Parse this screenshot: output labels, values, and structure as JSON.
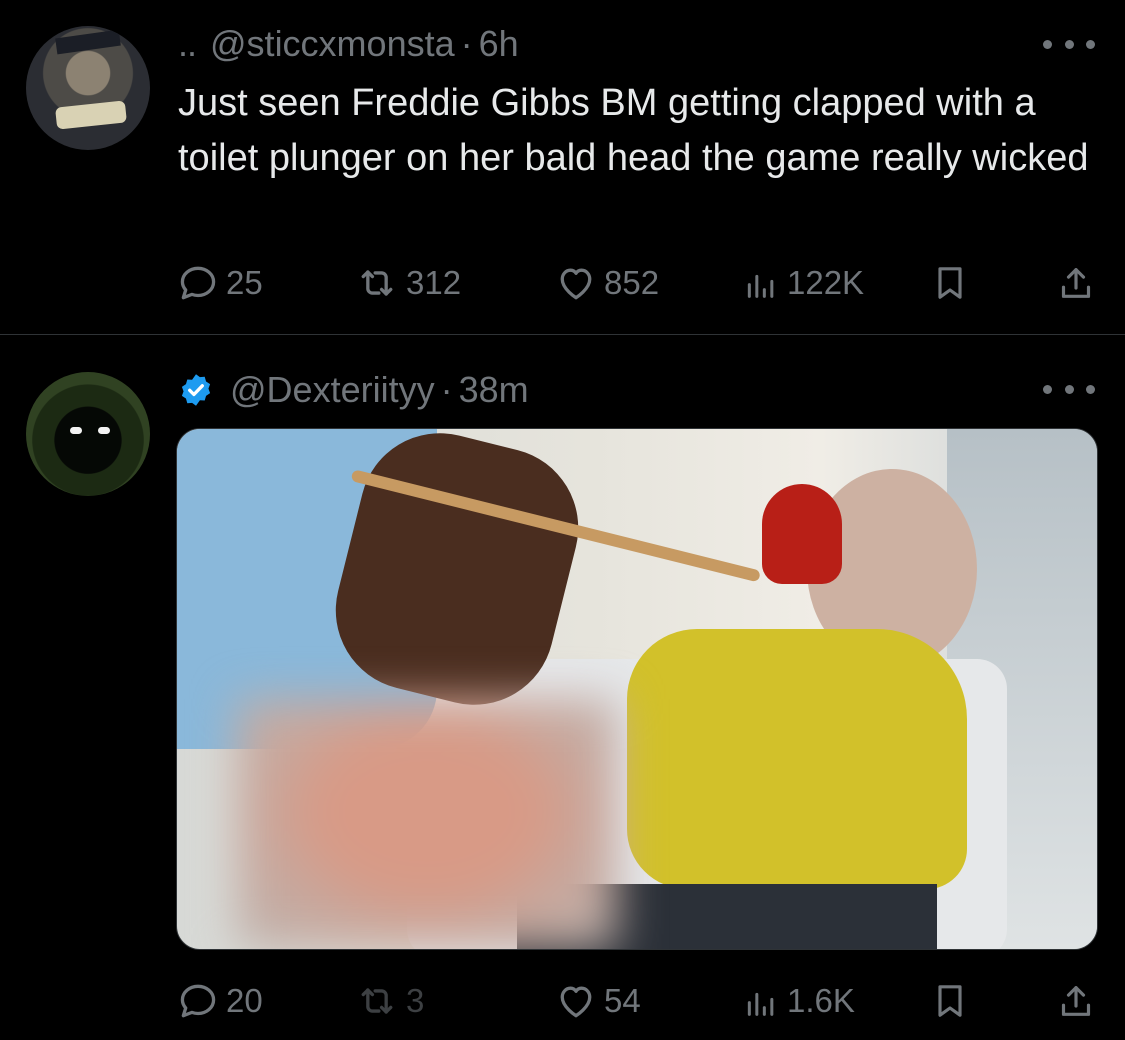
{
  "tweets": [
    {
      "prefix": "..",
      "handle": "@sticcxmonsta",
      "separator": "·",
      "time": "6h",
      "verified": false,
      "text": "Just seen Freddie Gibbs BM getting clapped with a toilet plunger on her bald head the game really wicked",
      "replies": "25",
      "retweets": "312",
      "likes": "852",
      "views": "122K"
    },
    {
      "handle": "@Dexteriityy",
      "separator": "·",
      "time": "38m",
      "verified": true,
      "media": "photo",
      "replies": "20",
      "retweets": "3",
      "likes": "54",
      "views": "1.6K"
    }
  ],
  "colors": {
    "background": "#000000",
    "text": "#e7e9ea",
    "secondary": "#71767b",
    "verified": "#1d9bf0",
    "divider": "#2f3336"
  },
  "icons": [
    "more-icon",
    "verified-badge-icon",
    "reply-icon",
    "retweet-icon",
    "like-icon",
    "views-icon",
    "bookmark-icon",
    "share-icon"
  ]
}
